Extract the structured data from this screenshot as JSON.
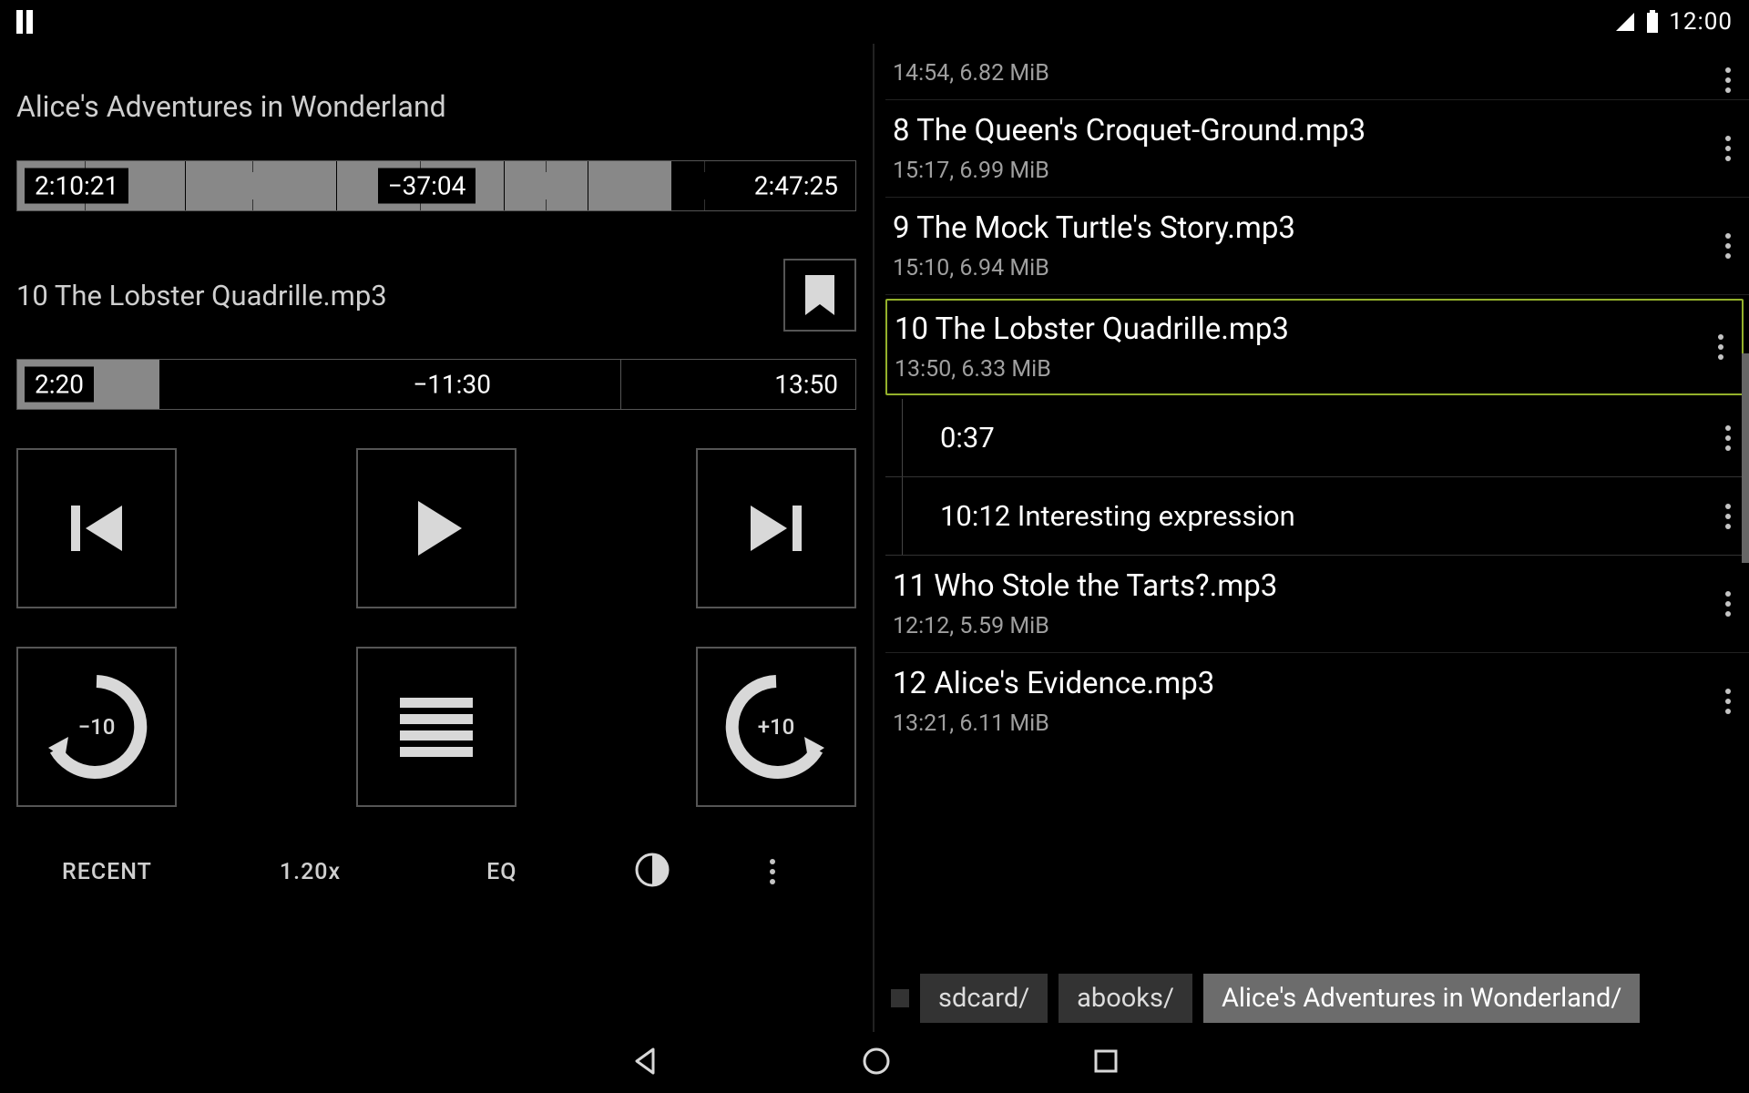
{
  "status": {
    "time": "12:00"
  },
  "player": {
    "book_title": "Alice's Adventures in Wonderland",
    "overall": {
      "elapsed": "2:10:21",
      "remaining": "−37:04",
      "total": "2:47:25"
    },
    "current_file": "10 The Lobster Quadrille.mp3",
    "chapter": {
      "elapsed": "2:20",
      "remaining": "−11:30",
      "total": "13:50"
    },
    "rewind_label": "−10",
    "forward_label": "+10"
  },
  "toolbar": {
    "recent": "RECENT",
    "speed": "1.20x",
    "eq": "EQ"
  },
  "tracks": [
    {
      "meta": "14:54, 6.82 MiB"
    },
    {
      "title": "8 The Queen's Croquet-Ground.mp3",
      "meta": "15:17, 6.99 MiB"
    },
    {
      "title": "9 The Mock Turtle's Story.mp3",
      "meta": "15:10, 6.94 MiB"
    },
    {
      "title": "10 The Lobster Quadrille.mp3",
      "meta": "13:50, 6.33 MiB",
      "selected": true
    },
    {
      "title": "11 Who Stole the Tarts?.mp3",
      "meta": "12:12, 5.59 MiB"
    },
    {
      "title": "12 Alice's Evidence.mp3",
      "meta": "13:21, 6.11 MiB"
    }
  ],
  "bookmarks": [
    {
      "label": "0:37"
    },
    {
      "label": "10:12 Interesting expression"
    }
  ],
  "breadcrumb": {
    "root": "",
    "sdcard": "sdcard/",
    "abooks": "abooks/",
    "current": "Alice's Adventures in Wonderland/"
  }
}
